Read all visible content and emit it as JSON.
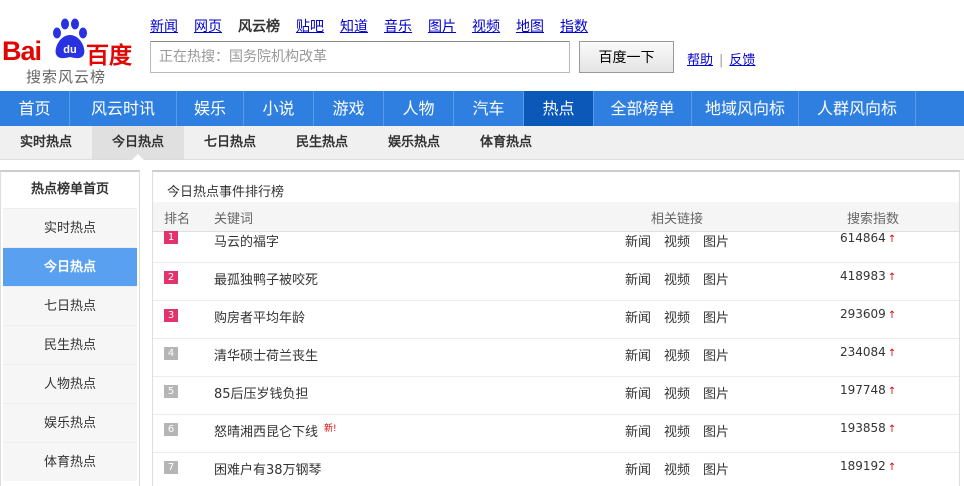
{
  "logo": {
    "bai": "Bai",
    "du": "du",
    "baidu_cn": "百度",
    "subtitle": "搜索风云榜"
  },
  "topnav": [
    {
      "label": "新闻",
      "current": false
    },
    {
      "label": "网页",
      "current": false
    },
    {
      "label": "风云榜",
      "current": true
    },
    {
      "label": "贴吧",
      "current": false
    },
    {
      "label": "知道",
      "current": false
    },
    {
      "label": "音乐",
      "current": false
    },
    {
      "label": "图片",
      "current": false
    },
    {
      "label": "视频",
      "current": false
    },
    {
      "label": "地图",
      "current": false
    },
    {
      "label": "指数",
      "current": false
    }
  ],
  "search": {
    "placeholder": "正在热搜：国务院机构改革",
    "button": "百度一下"
  },
  "help": {
    "help": "帮助",
    "sep": "|",
    "feedback": "反馈"
  },
  "mainnav": [
    {
      "label": "首页",
      "w": 0
    },
    {
      "label": "风云时讯"
    },
    {
      "label": "娱乐"
    },
    {
      "label": "小说"
    },
    {
      "label": "游戏"
    },
    {
      "label": "人物"
    },
    {
      "label": "汽车"
    },
    {
      "label": "热点",
      "active": true
    },
    {
      "label": "全部榜单"
    },
    {
      "label": "地域风向标"
    },
    {
      "label": "人群风向标"
    }
  ],
  "subnav": [
    {
      "label": "实时热点"
    },
    {
      "label": "今日热点",
      "active": true
    },
    {
      "label": "七日热点"
    },
    {
      "label": "民生热点"
    },
    {
      "label": "娱乐热点"
    },
    {
      "label": "体育热点"
    }
  ],
  "sidebar": {
    "title": "热点榜单首页",
    "items": [
      {
        "label": "实时热点"
      },
      {
        "label": "今日热点",
        "active": true
      },
      {
        "label": "七日热点"
      },
      {
        "label": "民生热点"
      },
      {
        "label": "人物热点"
      },
      {
        "label": "娱乐热点"
      },
      {
        "label": "体育热点"
      }
    ]
  },
  "panel": {
    "title": "今日热点事件排行榜",
    "headers": {
      "rank": "排名",
      "keyword": "关键词",
      "links": "相关链接",
      "index": "搜索指数"
    },
    "rows": [
      {
        "rank": "1",
        "keyword": "马云的福字",
        "tag": "",
        "index": "614864"
      },
      {
        "rank": "2",
        "keyword": "最孤独鸭子被咬死",
        "tag": "",
        "index": "418983"
      },
      {
        "rank": "3",
        "keyword": "购房者平均年龄",
        "tag": "",
        "index": "293609"
      },
      {
        "rank": "4",
        "keyword": "清华硕士荷兰丧生",
        "tag": "",
        "index": "234084"
      },
      {
        "rank": "5",
        "keyword": "85后压岁钱负担",
        "tag": "",
        "index": "197748"
      },
      {
        "rank": "6",
        "keyword": "怒晴湘西昆仑下线",
        "tag": "新!",
        "index": "193858"
      },
      {
        "rank": "7",
        "keyword": "困难户有38万钢琴",
        "tag": "",
        "index": "189192"
      }
    ],
    "link_labels": [
      "新闻",
      "视频",
      "图片"
    ],
    "up_arrow": "↑"
  },
  "colors": {
    "nav_blue": "#2f7fe0",
    "nav_active": "#0b58b8",
    "rank_hot": "#e2336a",
    "rank_normal": "#b5b5b5",
    "baidu_red": "#e10601"
  }
}
